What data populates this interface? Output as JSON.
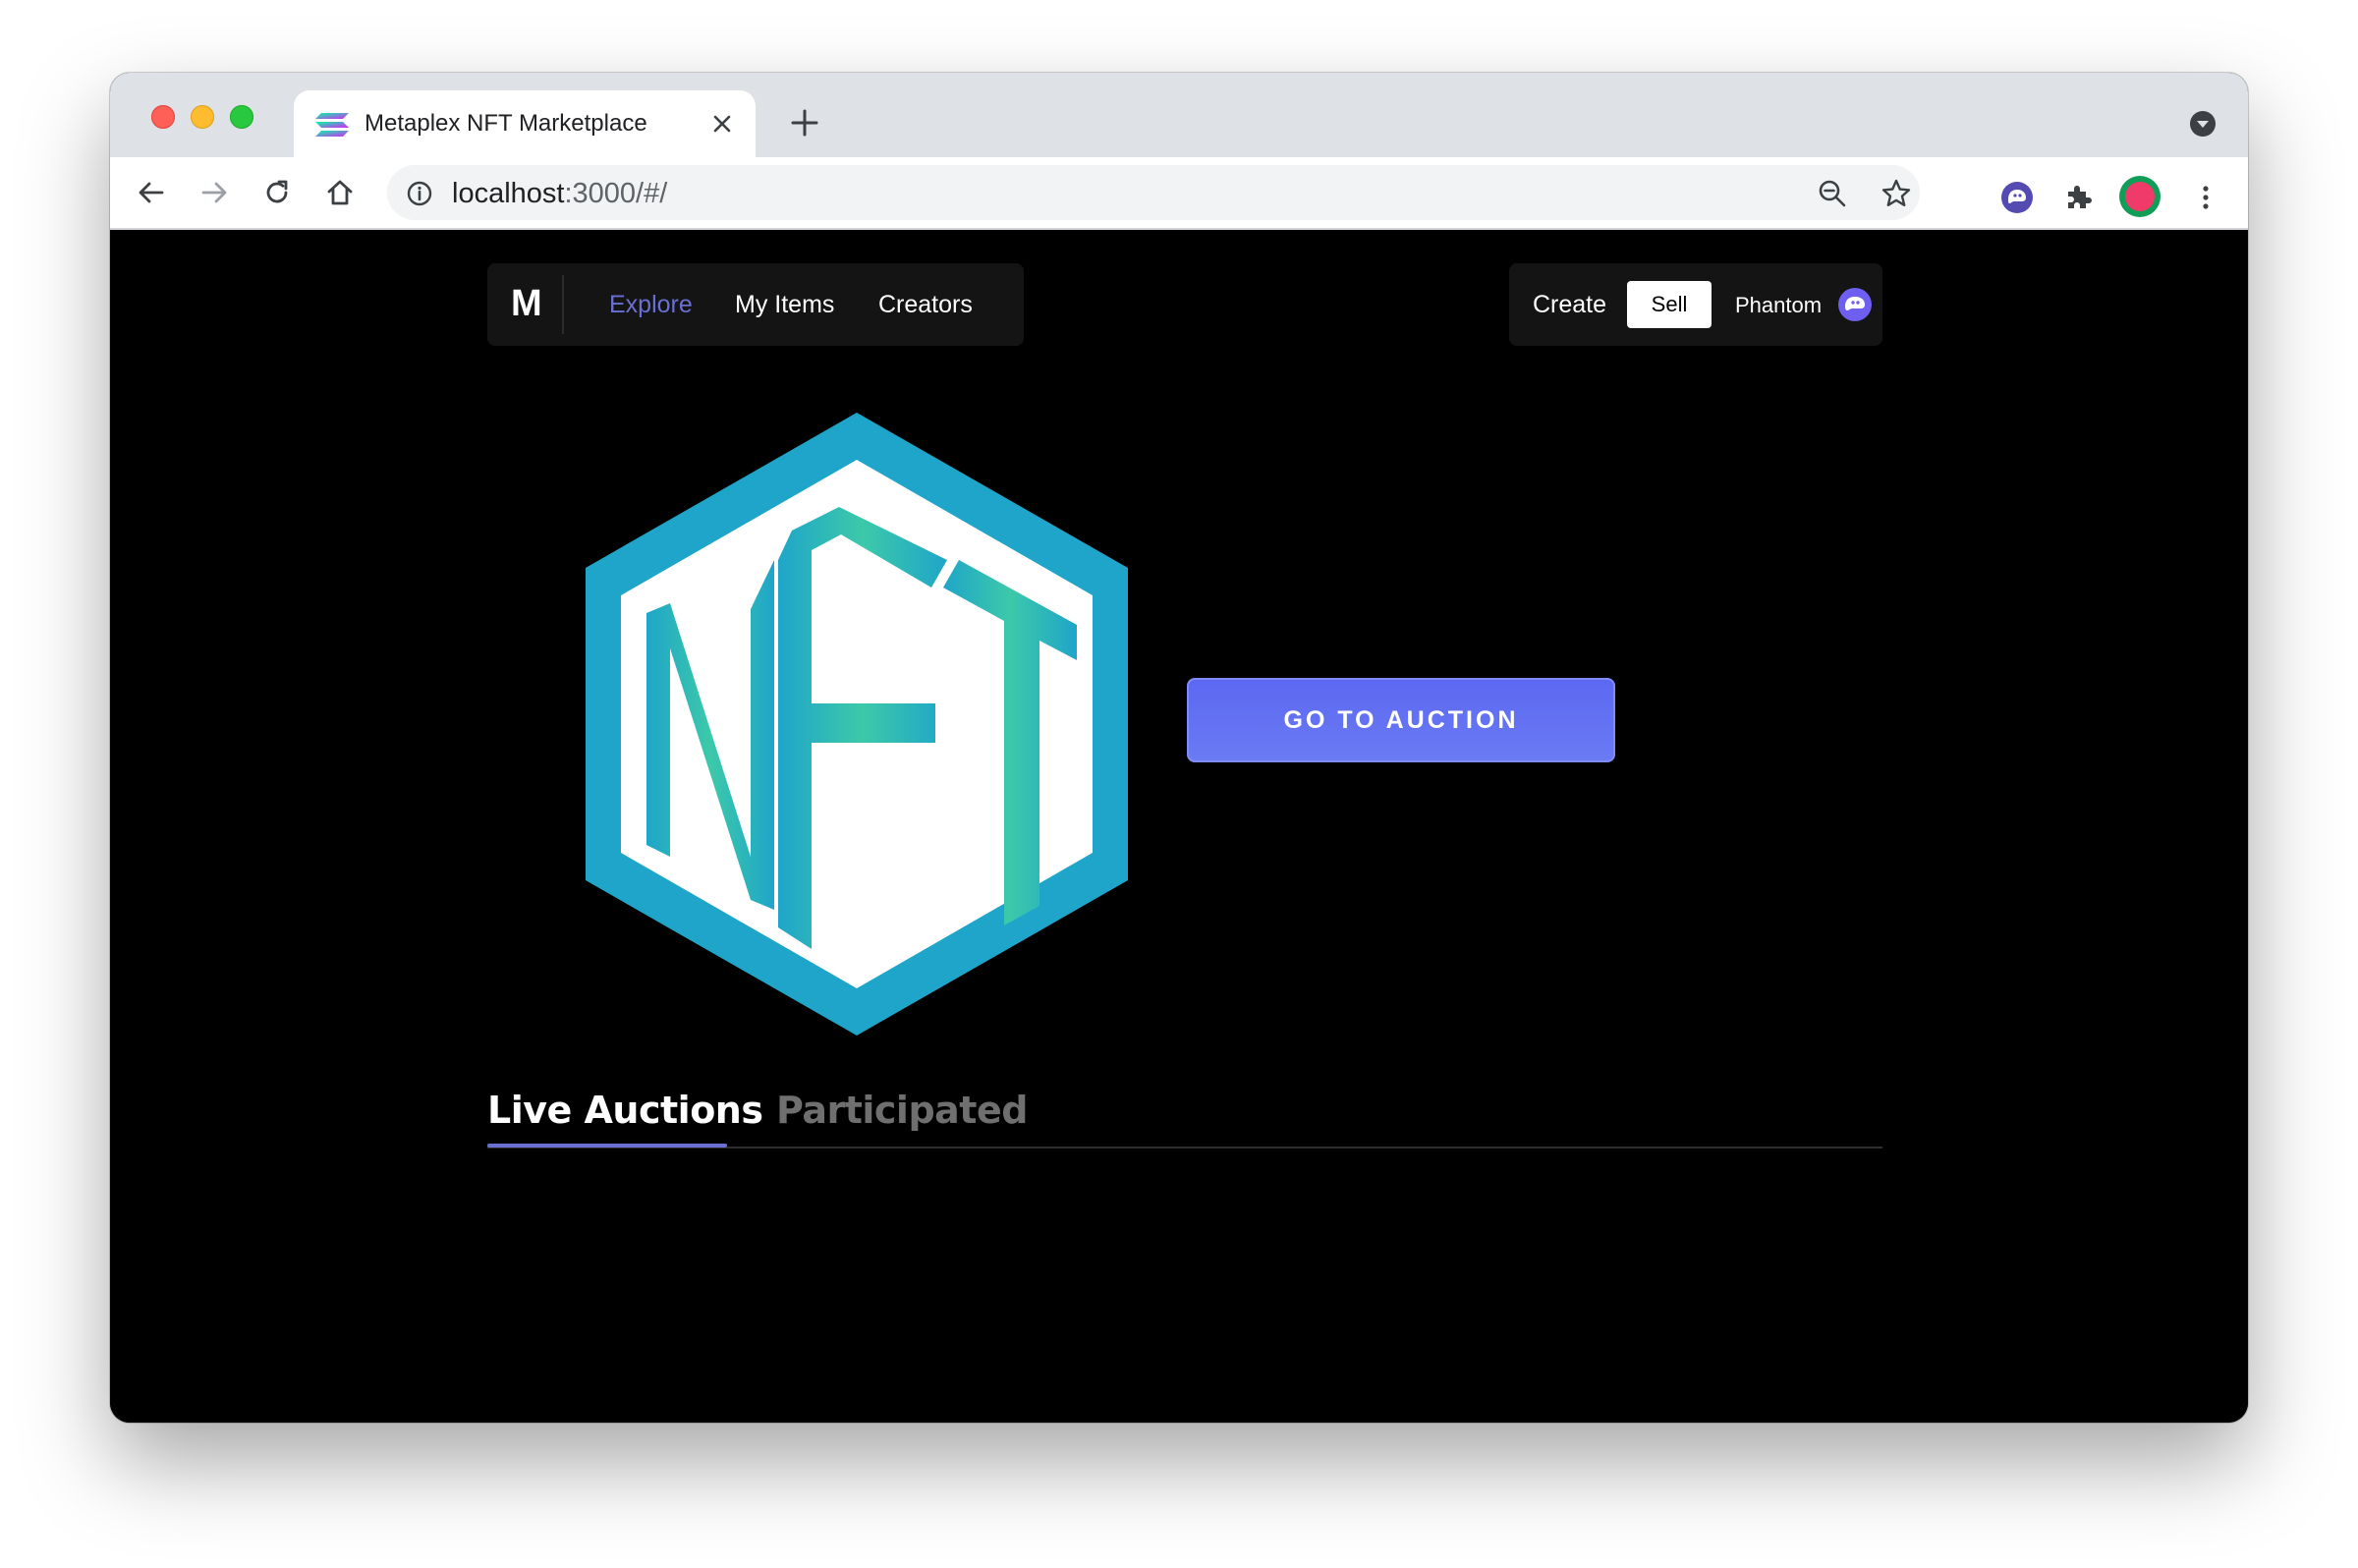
{
  "browser": {
    "tab": {
      "title": "Metaplex NFT Marketplace"
    },
    "url": {
      "host": "localhost",
      "rest": ":3000/#/"
    }
  },
  "nav": {
    "brand": "M",
    "links": [
      {
        "label": "Explore",
        "active": true
      },
      {
        "label": "My Items",
        "active": false
      },
      {
        "label": "Creators",
        "active": false
      }
    ],
    "create_label": "Create",
    "sell_label": "Sell",
    "wallet_label": "Phantom"
  },
  "hero": {
    "logo_text": "NFT",
    "cta_label": "GO TO AUCTION"
  },
  "auction_tabs": [
    {
      "label": "Live Auctions",
      "active": true
    },
    {
      "label": "Participated",
      "active": false
    }
  ],
  "colors": {
    "accent": "#6a6fd1",
    "cta": "#5c68f2",
    "logo_border": "#1fa5c9",
    "logo_letters_teal": "#3cc4a8"
  },
  "icons": {
    "favicon": "solana-icon",
    "wallet": "phantom-ghost-icon",
    "profile": "profile-avatar-icon"
  }
}
